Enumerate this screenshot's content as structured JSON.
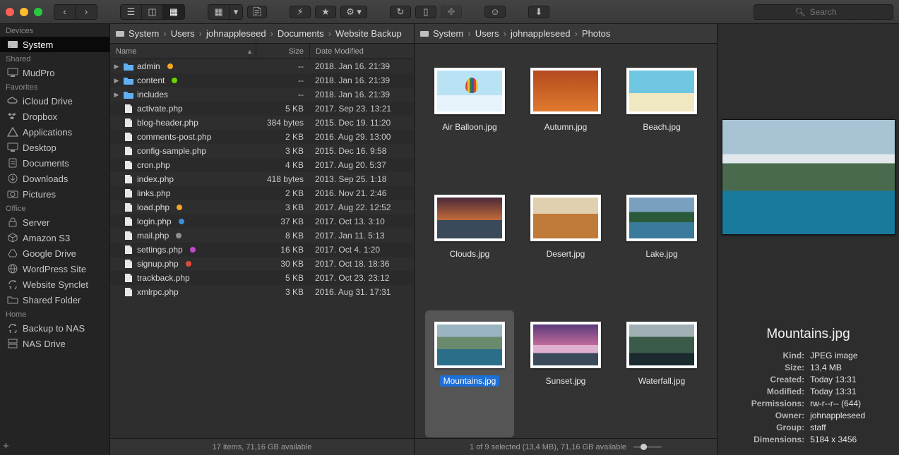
{
  "search": {
    "placeholder": "Search"
  },
  "sidebar": {
    "sections": [
      {
        "title": "Devices",
        "items": [
          {
            "icon": "disk",
            "label": "System",
            "selected": true
          }
        ]
      },
      {
        "title": "Shared",
        "items": [
          {
            "icon": "monitor",
            "label": "MudPro"
          }
        ]
      },
      {
        "title": "Favorites",
        "items": [
          {
            "icon": "cloud",
            "label": "iCloud Drive"
          },
          {
            "icon": "dropbox",
            "label": "Dropbox"
          },
          {
            "icon": "apps",
            "label": "Applications"
          },
          {
            "icon": "monitor",
            "label": "Desktop"
          },
          {
            "icon": "doc",
            "label": "Documents"
          },
          {
            "icon": "download",
            "label": "Downloads"
          },
          {
            "icon": "camera",
            "label": "Pictures"
          }
        ]
      },
      {
        "title": "Office",
        "items": [
          {
            "icon": "lock",
            "label": "Server"
          },
          {
            "icon": "cube",
            "label": "Amazon S3"
          },
          {
            "icon": "gdrive",
            "label": "Google Drive"
          },
          {
            "icon": "globe",
            "label": "WordPress Site"
          },
          {
            "icon": "sync",
            "label": "Website Synclet"
          },
          {
            "icon": "folder-o",
            "label": "Shared Folder"
          }
        ]
      },
      {
        "title": "Home",
        "items": [
          {
            "icon": "sync",
            "label": "Backup to NAS"
          },
          {
            "icon": "server",
            "label": "NAS Drive"
          }
        ]
      }
    ]
  },
  "pane1": {
    "crumbs": [
      "System",
      "Users",
      "johnappleseed",
      "Documents",
      "Website Backup"
    ],
    "columns": {
      "name": "Name",
      "size": "Size",
      "date": "Date Modified"
    },
    "rows": [
      {
        "kind": "folder",
        "expand": true,
        "name": "admin",
        "tag": "#f5a623",
        "size": "--",
        "date": "2018. Jan 16. 21:39"
      },
      {
        "kind": "folder",
        "expand": true,
        "name": "content",
        "tag": "#6dd400",
        "size": "--",
        "date": "2018. Jan 16. 21:39"
      },
      {
        "kind": "folder",
        "expand": true,
        "name": "includes",
        "tag": "",
        "size": "--",
        "date": "2018. Jan 16. 21:39"
      },
      {
        "kind": "file",
        "name": "activate.php",
        "size": "5 KB",
        "date": "2017. Sep 23. 13:21"
      },
      {
        "kind": "file",
        "name": "blog-header.php",
        "size": "384 bytes",
        "date": "2015. Dec 19. 11:20"
      },
      {
        "kind": "file",
        "name": "comments-post.php",
        "size": "2 KB",
        "date": "2016. Aug 29. 13:00"
      },
      {
        "kind": "file",
        "name": "config-sample.php",
        "size": "3 KB",
        "date": "2015. Dec 16. 9:58"
      },
      {
        "kind": "file",
        "name": "cron.php",
        "size": "4 KB",
        "date": "2017. Aug 20. 5:37"
      },
      {
        "kind": "file",
        "name": "index.php",
        "size": "418 bytes",
        "date": "2013. Sep 25. 1:18"
      },
      {
        "kind": "file",
        "name": "links.php",
        "size": "2 KB",
        "date": "2016. Nov 21. 2:46"
      },
      {
        "kind": "file",
        "name": "load.php",
        "tag": "#f5a623",
        "size": "3 KB",
        "date": "2017. Aug 22. 12:52"
      },
      {
        "kind": "file",
        "name": "login.php",
        "tag": "#3a8fe0",
        "size": "37 KB",
        "date": "2017. Oct 13. 3:10"
      },
      {
        "kind": "file",
        "name": "mail.php",
        "tag": "#8e8e8e",
        "size": "8 KB",
        "date": "2017. Jan 11. 5:13"
      },
      {
        "kind": "file",
        "name": "settings.php",
        "tag": "#c04ad0",
        "size": "16 KB",
        "date": "2017. Oct 4. 1:20"
      },
      {
        "kind": "file",
        "name": "signup.php",
        "tag": "#e04a3a",
        "size": "30 KB",
        "date": "2017. Oct 18. 18:36"
      },
      {
        "kind": "file",
        "name": "trackback.php",
        "size": "5 KB",
        "date": "2017. Oct 23. 23:12"
      },
      {
        "kind": "file",
        "name": "xmlrpc.php",
        "size": "3 KB",
        "date": "2016. Aug 31. 17:31"
      }
    ],
    "status": "17 items, 71,16 GB available"
  },
  "pane2": {
    "crumbs": [
      "System",
      "Users",
      "johnappleseed",
      "Photos"
    ],
    "items": [
      {
        "label": "Air Balloon.jpg",
        "cls": "th-balloon"
      },
      {
        "label": "Autumn.jpg",
        "cls": "th-autumn"
      },
      {
        "label": "Beach.jpg",
        "cls": "th-beach"
      },
      {
        "label": "Clouds.jpg",
        "cls": "th-clouds"
      },
      {
        "label": "Desert.jpg",
        "cls": "th-desert"
      },
      {
        "label": "Lake.jpg",
        "cls": "th-lake"
      },
      {
        "label": "Mountains.jpg",
        "cls": "th-mountains",
        "selected": true
      },
      {
        "label": "Sunset.jpg",
        "cls": "th-sunset"
      },
      {
        "label": "Waterfall.jpg",
        "cls": "th-waterfall"
      }
    ],
    "status": "1 of 9 selected (13,4 MB), 71,16 GB available"
  },
  "info": {
    "name": "Mountains.jpg",
    "rows": [
      {
        "k": "Kind:",
        "v": "JPEG image"
      },
      {
        "k": "Size:",
        "v": "13,4 MB"
      },
      {
        "k": "Created:",
        "v": "Today 13:31"
      },
      {
        "k": "Modified:",
        "v": "Today 13:31"
      },
      {
        "k": "Permissions:",
        "v": "rw-r--r-- (644)"
      },
      {
        "k": "Owner:",
        "v": "johnappleseed"
      },
      {
        "k": "Group:",
        "v": "staff"
      },
      {
        "k": "Dimensions:",
        "v": "5184 x 3456"
      }
    ]
  }
}
